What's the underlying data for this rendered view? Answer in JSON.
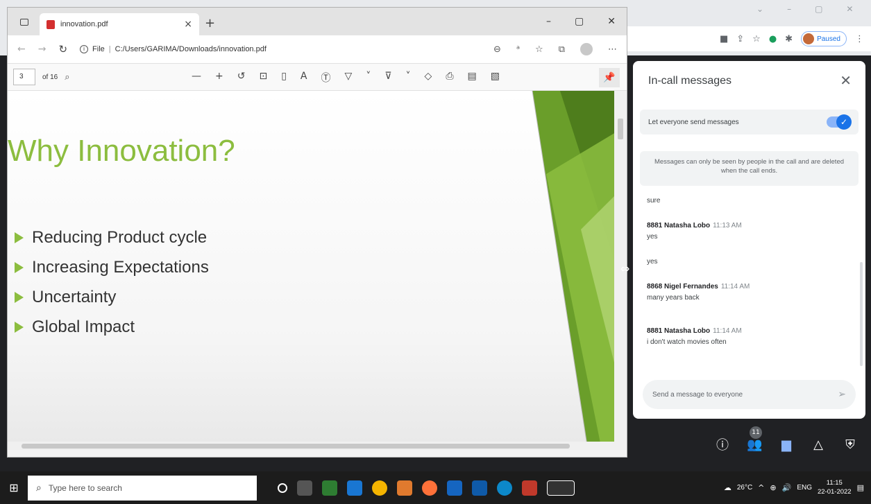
{
  "chrome": {
    "paused_label": "Paused",
    "window_controls": [
      "˅",
      "–",
      "⧉",
      "✕"
    ]
  },
  "edge": {
    "tab_title": "innovation.pdf",
    "url_prefix": "File",
    "url": "C:/Users/GARIMA/Downloads/innovation.pdf",
    "page_current": "3",
    "page_total": "of 16"
  },
  "slide": {
    "title": "Why Innovation?",
    "bullets": [
      "Reducing Product cycle",
      "Increasing Expectations",
      "Uncertainty",
      "Global Impact"
    ],
    "accent_color": "#8cbd3f"
  },
  "meet": {
    "panel_title": "In-call messages",
    "toggle_label": "Let everyone send messages",
    "toggle_on": true,
    "notice": "Messages can only be seen by people in the call and are deleted when the call ends.",
    "messages": [
      {
        "sender": "",
        "time": "",
        "text": "sure"
      },
      {
        "sender": "8881 Natasha Lobo",
        "time": "11:13 AM",
        "text": "yes"
      },
      {
        "sender": "",
        "time": "",
        "text": "yes"
      },
      {
        "sender": "8868 Nigel Fernandes",
        "time": "11:14 AM",
        "text": "many years back"
      },
      {
        "sender": "8881 Natasha Lobo",
        "time": "11:14 AM",
        "text": "i don't watch movies often"
      }
    ],
    "compose_placeholder": "Send a message to everyone",
    "participants_count": "11"
  },
  "taskbar": {
    "search_placeholder": "Type here to search",
    "temperature": "26°C",
    "language": "ENG",
    "time": "11:15",
    "date": "22-01-2022"
  }
}
